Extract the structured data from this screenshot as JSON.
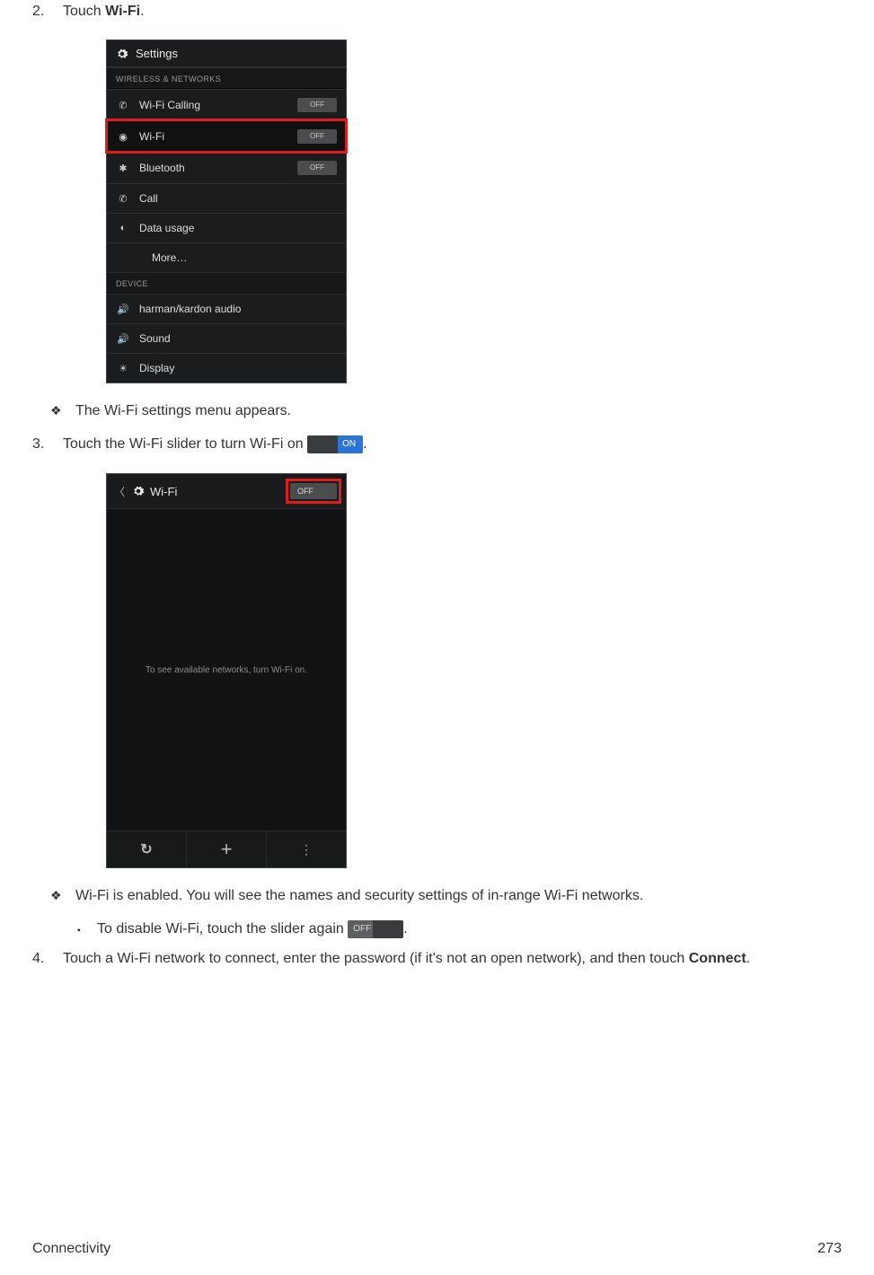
{
  "steps": {
    "s2": {
      "num": "2.",
      "text_before": "Touch ",
      "bold": "Wi-Fi",
      "text_after": "."
    },
    "s2_sub": "The Wi-Fi settings menu appears.",
    "s3": {
      "num": "3.",
      "text": "Touch the Wi-Fi slider to turn Wi-Fi on ",
      "after": "."
    },
    "s3_sub": "Wi-Fi is enabled. You will see the names and security settings of in-range Wi-Fi networks.",
    "s3_subsub": {
      "text": "To disable Wi-Fi, touch the slider again ",
      "after": "."
    },
    "s4": {
      "num": "4.",
      "text_before": "Touch a Wi-Fi network to connect, enter the password (if it's not an open network), and then touch ",
      "bold": "Connect",
      "text_after": "."
    }
  },
  "slider_on_label": "ON",
  "slider_off_label": "OFF",
  "screenshot1": {
    "header": "Settings",
    "section1": "WIRELESS & NETWORKS",
    "rows1": [
      {
        "icon": "phone-icon",
        "label": "Wi-Fi Calling",
        "toggle": "OFF"
      },
      {
        "icon": "wifi-icon",
        "label": "Wi-Fi",
        "toggle": "OFF",
        "highlight": true
      },
      {
        "icon": "bluetooth-icon",
        "label": "Bluetooth",
        "toggle": "OFF"
      },
      {
        "icon": "call-icon",
        "label": "Call"
      },
      {
        "icon": "data-icon",
        "label": "Data usage"
      },
      {
        "icon": "more-icon",
        "label": "More…",
        "indent": true
      }
    ],
    "section2": "DEVICE",
    "rows2": [
      {
        "icon": "speaker-icon",
        "label": "harman/kardon audio"
      },
      {
        "icon": "sound-icon",
        "label": "Sound"
      },
      {
        "icon": "display-icon",
        "label": "Display"
      }
    ]
  },
  "screenshot2": {
    "title": "Wi-Fi",
    "toggle": "OFF",
    "body_message": "To see available networks, turn Wi-Fi on.",
    "bottom": {
      "refresh": "↻",
      "add": "+",
      "menu": "⋮"
    }
  },
  "footer": {
    "left": "Connectivity",
    "right": "273"
  }
}
